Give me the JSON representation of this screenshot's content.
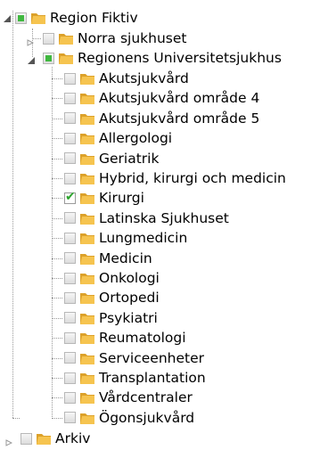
{
  "tree": {
    "root": {
      "label": "Region Fiktiv",
      "state": "partial",
      "expanded": true
    },
    "level1": [
      {
        "label": "Norra sjukhuset",
        "state": "unchecked",
        "expanded": false
      },
      {
        "label": "Regionens Universitetsjukhus",
        "state": "partial",
        "expanded": true
      }
    ],
    "departments": [
      {
        "label": "Akutsjukvård",
        "state": "unchecked"
      },
      {
        "label": "Akutsjukvård område 4",
        "state": "unchecked"
      },
      {
        "label": "Akutsjukvård område 5",
        "state": "unchecked"
      },
      {
        "label": "Allergologi",
        "state": "unchecked"
      },
      {
        "label": "Geriatrik",
        "state": "unchecked"
      },
      {
        "label": "Hybrid, kirurgi och medicin",
        "state": "unchecked"
      },
      {
        "label": "Kirurgi",
        "state": "checked"
      },
      {
        "label": "Latinska Sjukhuset",
        "state": "unchecked"
      },
      {
        "label": "Lungmedicin",
        "state": "unchecked"
      },
      {
        "label": "Medicin",
        "state": "unchecked"
      },
      {
        "label": "Onkologi",
        "state": "unchecked"
      },
      {
        "label": "Ortopedi",
        "state": "unchecked"
      },
      {
        "label": "Psykiatri",
        "state": "unchecked"
      },
      {
        "label": "Reumatologi",
        "state": "unchecked"
      },
      {
        "label": "Serviceenheter",
        "state": "unchecked"
      },
      {
        "label": "Transplantation",
        "state": "unchecked"
      },
      {
        "label": "Vårdcentraler",
        "state": "unchecked"
      },
      {
        "label": "Ögonsjukvård",
        "state": "unchecked"
      }
    ],
    "archive": {
      "label": "Arkiv",
      "state": "unchecked",
      "expanded": false
    }
  },
  "colors": {
    "checkbox_fill": "#3fb83f",
    "checkmark": "#2ea52e",
    "folder_front": "#f6c44f",
    "folder_back": "#dca12a"
  }
}
